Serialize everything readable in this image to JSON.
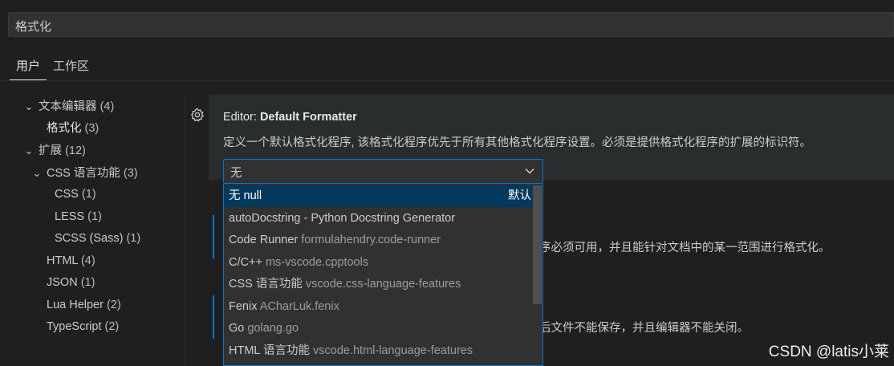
{
  "search": {
    "value": "格式化"
  },
  "scope_tabs": [
    {
      "label": "用户",
      "active": true
    },
    {
      "label": "工作区",
      "active": false
    }
  ],
  "toc": [
    {
      "label": "文本编辑器",
      "count": "(4)",
      "expanded": true
    },
    {
      "label": "格式化",
      "count": "(3)",
      "selected": true
    },
    {
      "label": "扩展",
      "count": "(12)",
      "expanded": true
    },
    {
      "label": "CSS 语言功能",
      "count": "(3)",
      "expanded": true
    },
    {
      "label": "CSS",
      "count": "(1)"
    },
    {
      "label": "LESS",
      "count": "(1)"
    },
    {
      "label": "SCSS (Sass)",
      "count": "(1)"
    },
    {
      "label": "HTML",
      "count": "(4)"
    },
    {
      "label": "JSON",
      "count": "(1)"
    },
    {
      "label": "Lua Helper",
      "count": "(2)"
    },
    {
      "label": "TypeScript",
      "count": "(2)"
    }
  ],
  "setting": {
    "title_prefix": "Editor: ",
    "title_name": "Default Formatter",
    "description": "定义一个默认格式化程序, 该格式化程序优先于所有其他格式化程序设置。必须是提供格式化程序的扩展的标识符。",
    "selected_value": "无"
  },
  "dropdown_options": [
    {
      "name": "无",
      "ext": "null",
      "default_label": "默认",
      "highlighted": true
    },
    {
      "name": "autoDocstring - Python Docstring Generator",
      "ext": ""
    },
    {
      "name": "Code Runner",
      "ext": "formulahendry.code-runner"
    },
    {
      "name": "C/C++",
      "ext": "ms-vscode.cpptools"
    },
    {
      "name": "CSS 语言功能",
      "ext": "vscode.css-language-features"
    },
    {
      "name": "Fenix",
      "ext": "ACharLuk.fenix"
    },
    {
      "name": "Go",
      "ext": "golang.go"
    },
    {
      "name": "HTML 语言功能",
      "ext": "vscode.html-language-features"
    }
  ],
  "background_text": {
    "line1": "序必须可用，并且能针对文档中的某一范围进行格式化。",
    "line2": "后文件不能保存，并且编辑器不能关闭。"
  },
  "watermark": "CSDN @latis小莱",
  "colors": {
    "accent": "#0078d4",
    "highlight": "#04395e",
    "background": "#1f1f1f"
  },
  "icons": {
    "setting": "gear-icon",
    "select": "chevron-down-icon",
    "tree": "chevron-down-icon"
  }
}
